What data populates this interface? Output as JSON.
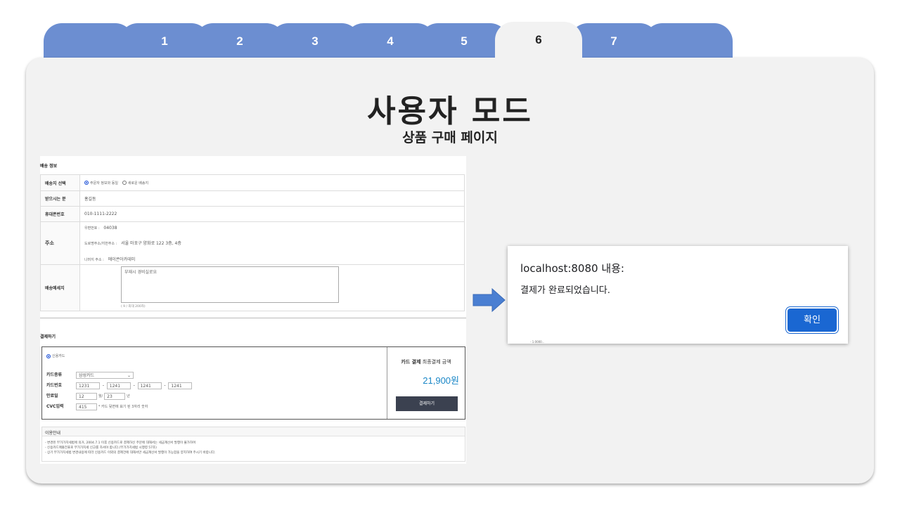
{
  "tabs": [
    {
      "label": ""
    },
    {
      "label": "1"
    },
    {
      "label": "2"
    },
    {
      "label": "3"
    },
    {
      "label": "4"
    },
    {
      "label": "5"
    },
    {
      "label": "6"
    },
    {
      "label": "7"
    },
    {
      "label": ""
    }
  ],
  "header": {
    "title": "사용자 모드",
    "subtitle": "상품 구매 페이지"
  },
  "shipping": {
    "section_title": "배송 정보",
    "select_label": "배송지 선택",
    "option_same": "주문자 정보와 동일",
    "option_new": "새로운 배송지",
    "receiver_label": "받으시는 분",
    "receiver_value": "홍길동",
    "phone_label": "휴대폰번호",
    "phone_value": "010-1111-2222",
    "address_label": "주소",
    "zip_label": "우편번호 :",
    "zip_value": "04038",
    "road_label": "도로명주소/지번주소 :",
    "road_value": "서울 마포구 양화로 122 3층, 4층",
    "detail_label": "나머지 주소 :",
    "detail_value": "에이콘아카데미",
    "memo_label": "배송메세지",
    "memo_value": "부재시 경비실로요",
    "memo_count": "( 9 / 최대 200자)"
  },
  "payment": {
    "section_title": "결제하기",
    "method": "신용카드",
    "card_type_label": "카드종류",
    "card_type_value": "삼성카드",
    "card_no_label": "카드번호",
    "card_no": [
      "1231",
      "1241",
      "1241",
      "1241"
    ],
    "expiry_label": "만료일",
    "expiry_month": "12",
    "month_unit": "월/",
    "expiry_year": "23",
    "year_unit": "년",
    "cvc_label": "CVC입력",
    "cvc_value": "415",
    "cvc_hint": "* 카드 뒷면에 표기 된 3자리 숫자",
    "total_title_bold": "카드 결제",
    "total_title_rest": " 최종결제 금액",
    "total_amount": "21,900원",
    "pay_button": "결제하기"
  },
  "notice": {
    "title": "이용안내",
    "lines": [
      "- 변경된 부가가치세법에 의거, 2004.7.1 이후 신용카드로 결제하신 주문에 대해서는 세금계산서 발행이 불가하며",
      "- 신용카드매출전표로 부가가치세 신고를 하셔야 합니다.(부가가치세법 시행령 57조)",
      "- 상기 부가가치세법 변경내용에 따라 신용카드 이외의 결제건에 대해서만 세금계산서 발행이 가능함을 양지하여 주시기 바랍니다."
    ]
  },
  "dialog": {
    "title": "localhost:8080 내용:",
    "message": "결제가 완료되었습니다.",
    "ok_button": "확인",
    "hidden_text": "- 1.0000..."
  },
  "colors": {
    "tab": "#6c8ed1",
    "panel": "#f2f2f2",
    "arrow": "#4a7fd2",
    "dialog_button": "#1a67d2",
    "amount": "#1a87c7"
  }
}
